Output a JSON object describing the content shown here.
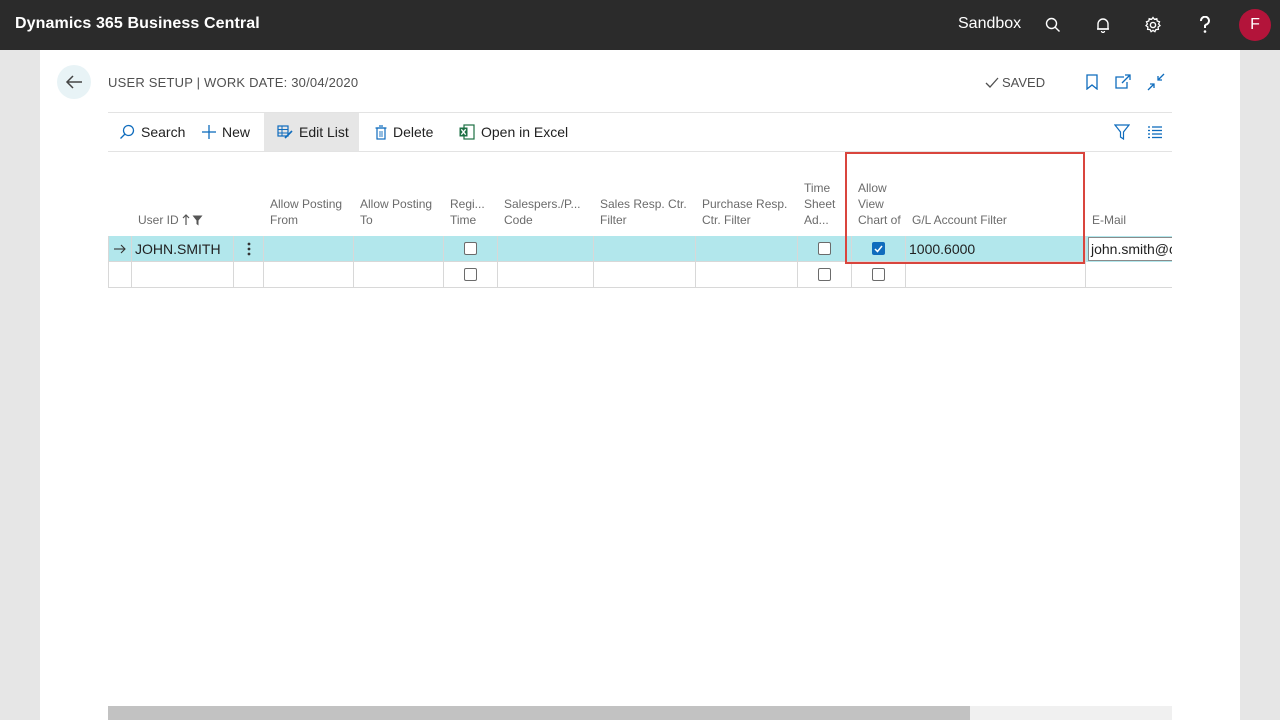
{
  "app": {
    "title": "Dynamics 365 Business Central",
    "environment": "Sandbox",
    "avatar_initial": "F",
    "avatar_color": "#b3143a"
  },
  "page": {
    "title": "USER SETUP | WORK DATE: 30/04/2020",
    "status": "SAVED"
  },
  "actions": {
    "search": "Search",
    "new": "New",
    "edit_list": "Edit List",
    "delete": "Delete",
    "open_in_excel": "Open in Excel"
  },
  "columns": {
    "user_id": "User ID",
    "allow_posting_from": "Allow Posting From",
    "allow_posting_to": "Allow Posting To",
    "register_time": "Regi... Time",
    "salespers_code": "Salespers./P... Code",
    "sales_resp_ctr_filter": "Sales Resp. Ctr. Filter",
    "purchase_resp_ctr_filter": "Purchase Resp. Ctr. Filter",
    "time_sheet_admin": "Time Sheet Ad...",
    "allow_view_chart_of": "Allow View Chart of",
    "gl_account_filter": "G/L Account Filter",
    "email": "E-Mail"
  },
  "rows": [
    {
      "user_id": "JOHN.SMITH",
      "register_time": false,
      "time_sheet_admin": false,
      "allow_view_chart_of": true,
      "gl_account_filter": "1000.6000",
      "email": "john.smith@c"
    },
    {
      "user_id": "",
      "register_time": false,
      "time_sheet_admin": false,
      "allow_view_chart_of": false,
      "gl_account_filter": "",
      "email": ""
    }
  ],
  "scrollbar": {
    "position_fraction": 0.81
  },
  "colors": {
    "accent": "#0f6cbd",
    "selected_row": "#b2e7ec",
    "highlight_border": "#d9453d",
    "appbar": "#2b2b2b"
  }
}
